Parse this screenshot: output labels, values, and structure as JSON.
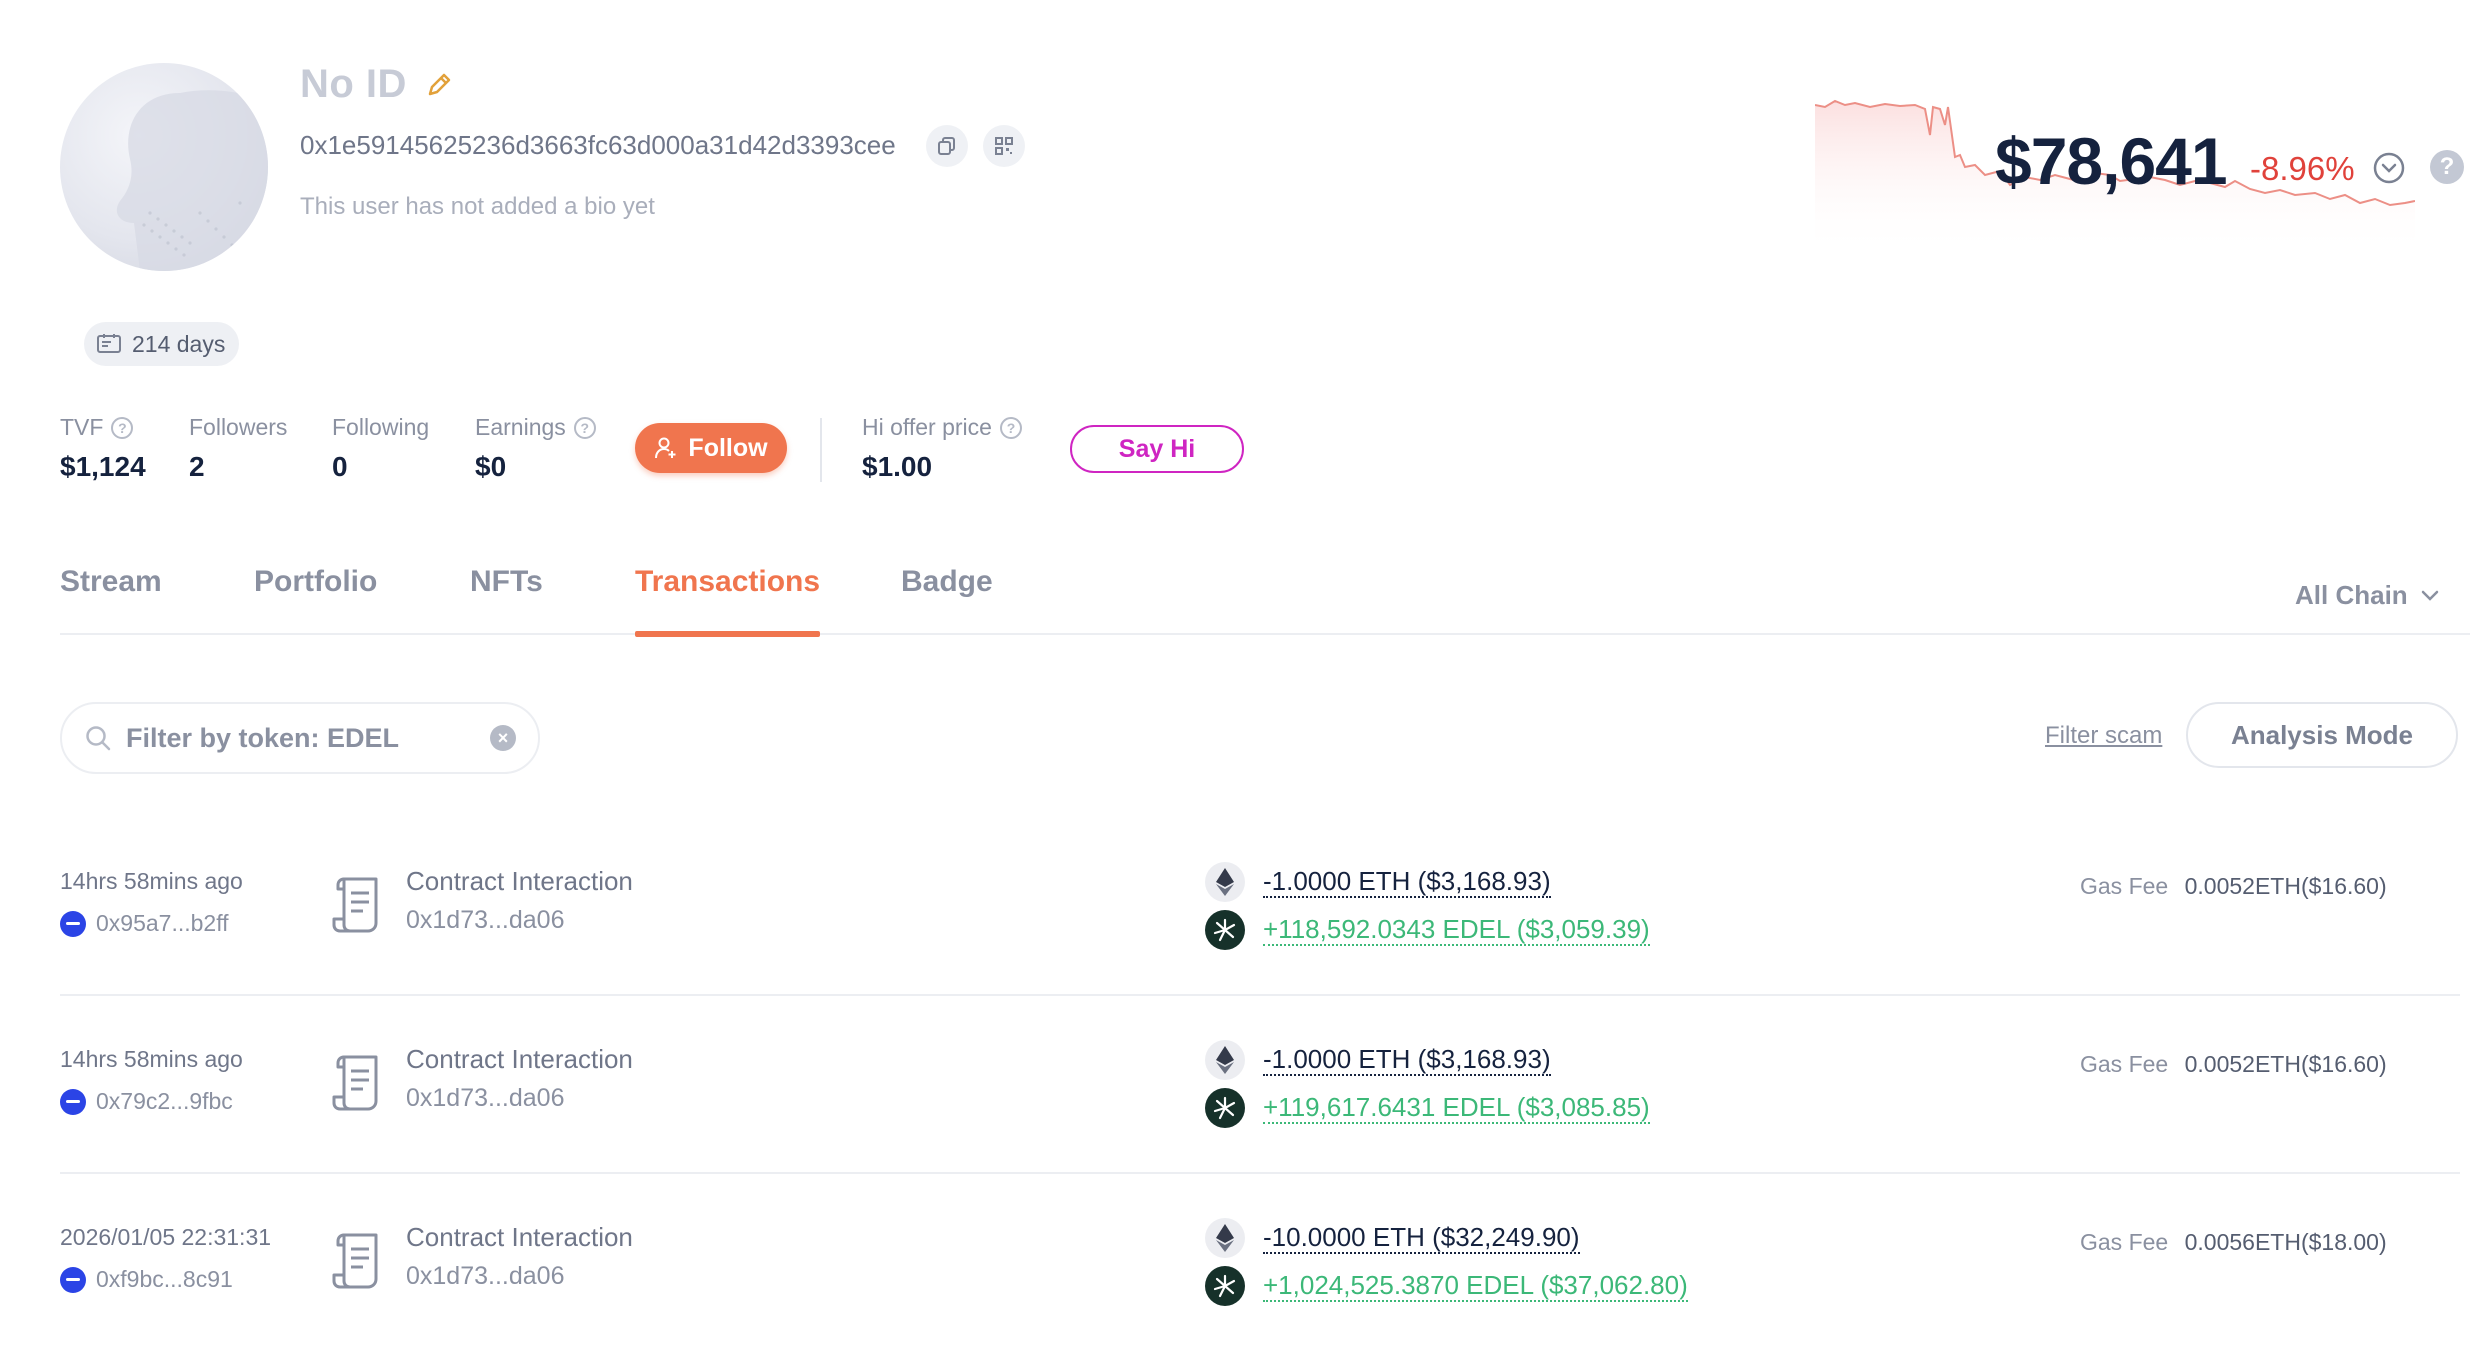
{
  "profile": {
    "name": "No ID",
    "address": "0x1e59145625236d3663fc63d000a31d42d3393cee",
    "bio": "This user has not added a bio yet",
    "days": "214 days"
  },
  "networth": {
    "value": "$78,641",
    "change": "-8.96%",
    "colors": {
      "line": "#ec8f86",
      "fill": "#fdeeee"
    }
  },
  "stats": {
    "tvf_label": "TVF",
    "tvf_value": "$1,124",
    "followers_label": "Followers",
    "followers_value": "2",
    "following_label": "Following",
    "following_value": "0",
    "earnings_label": "Earnings",
    "earnings_value": "$0",
    "follow_label": "Follow",
    "hi_offer_label": "Hi offer price",
    "hi_offer_value": "$1.00",
    "say_hi_label": "Say Hi"
  },
  "tabs": [
    "Stream",
    "Portfolio",
    "NFTs",
    "Transactions",
    "Badge"
  ],
  "active_tab": "Transactions",
  "chain_select": "All Chain",
  "filter": {
    "value": "Filter by token: EDEL",
    "filter_scam": "Filter scam",
    "analysis_mode": "Analysis Mode"
  },
  "transactions": [
    {
      "time": "14hrs 58mins ago",
      "from": "0x95a7...b2ff",
      "type": "Contract Interaction",
      "to": "0x1d73...da06",
      "out": "-1.0000 ETH ($3,168.93)",
      "in": "+118,592.0343 EDEL ($3,059.39)",
      "gas_label": "Gas Fee",
      "gas_value": "0.0052ETH($16.60)"
    },
    {
      "time": "14hrs 58mins ago",
      "from": "0x79c2...9fbc",
      "type": "Contract Interaction",
      "to": "0x1d73...da06",
      "out": "-1.0000 ETH ($3,168.93)",
      "in": "+119,617.6431 EDEL ($3,085.85)",
      "gas_label": "Gas Fee",
      "gas_value": "0.0052ETH($16.60)"
    },
    {
      "time": "2026/01/05 22:31:31",
      "from": "0xf9bc...8c91",
      "type": "Contract Interaction",
      "to": "0x1d73...da06",
      "out": "-10.0000 ETH ($32,249.90)",
      "in": "+1,024,525.3870 EDEL ($37,062.80)",
      "gas_label": "Gas Fee",
      "gas_value": "0.0056ETH($18.00)"
    }
  ],
  "colors": {
    "accent": "#f0754e",
    "say_hi": "#cf25c2",
    "positive": "#3cb878",
    "negative": "#e0423b"
  }
}
